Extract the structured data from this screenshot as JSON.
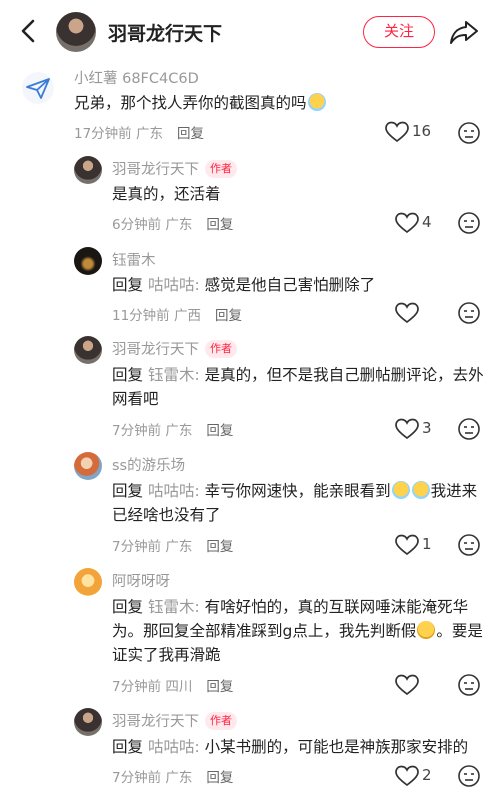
{
  "header": {
    "title": "羽哥龙行天下",
    "follow_label": "关注",
    "back_icon": "chevron-left-icon",
    "share_icon": "share-arrow-icon"
  },
  "comments": [
    {
      "name": "小红薯 68FC4C6D",
      "text": "兄弟，那个找人弄你的截图真的吗",
      "time": "17分钟前",
      "location": "广东",
      "reply": "回复",
      "likes": "16"
    },
    {
      "name": "羽哥龙行天下",
      "tag": "作者",
      "text": "是真的，还活着",
      "time": "6分钟前",
      "location": "广东",
      "reply": "回复",
      "likes": "4"
    },
    {
      "name": "钰雷木",
      "reply_prefix": "回复",
      "reply_to": "咕咕咕:",
      "text": "感觉是他自己害怕删除了",
      "time": "11分钟前",
      "location": "广西",
      "reply": "回复",
      "likes": ""
    },
    {
      "name": "羽哥龙行天下",
      "tag": "作者",
      "reply_prefix": "回复",
      "reply_to": "钰雷木:",
      "text": "是真的，但不是我自己删帖删评论，去外网看吧",
      "time": "7分钟前",
      "location": "广东",
      "reply": "回复",
      "likes": "3"
    },
    {
      "name": "ss的游乐场",
      "reply_prefix": "回复",
      "reply_to": "咕咕咕:",
      "text_a": "幸亏你网速快，能亲眼看到",
      "text_b": "我进来已经啥也没有了",
      "time": "7分钟前",
      "location": "广东",
      "reply": "回复",
      "likes": "1"
    },
    {
      "name": "阿呀呀呀",
      "reply_prefix": "回复",
      "reply_to": "钰雷木:",
      "text_a": "有啥好怕的，真的互联网唾沫能淹死华为。那回复全部精准踩到g点上，我先判断假",
      "text_b": "。要是证实了我再滑跪",
      "time": "7分钟前",
      "location": "四川",
      "reply": "回复",
      "likes": ""
    },
    {
      "name": "羽哥龙行天下",
      "tag": "作者",
      "reply_prefix": "回复",
      "reply_to": "咕咕咕:",
      "text": "小某书删的，可能也是神族那家安排的",
      "time": "7分钟前",
      "location": "广东",
      "reply": "回复",
      "likes": "2"
    }
  ],
  "colors": {
    "accent": "#ff2442",
    "tag_bg": "#ffe9ec",
    "muted": "#999999"
  }
}
